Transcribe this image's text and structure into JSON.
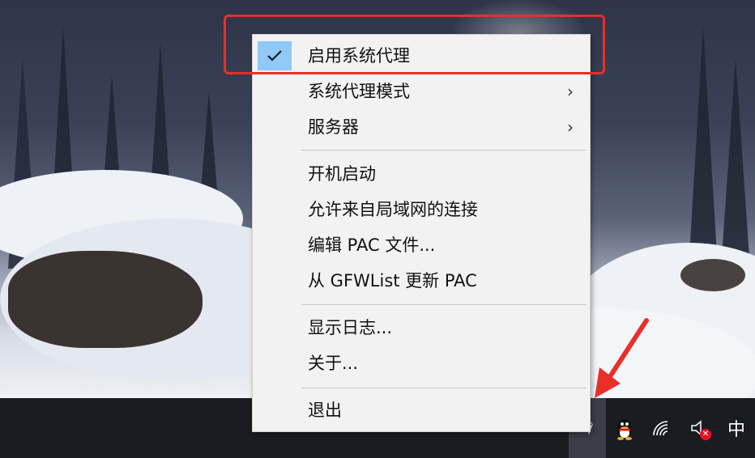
{
  "menu": {
    "items": [
      {
        "label": "启用系统代理",
        "checked": true,
        "submenu": false
      },
      {
        "label": "系统代理模式",
        "checked": false,
        "submenu": true
      },
      {
        "label": "服务器",
        "checked": false,
        "submenu": true
      },
      {
        "label": "开机启动",
        "checked": false,
        "submenu": false
      },
      {
        "label": "允许来自局域网的连接",
        "checked": false,
        "submenu": false
      },
      {
        "label": "编辑 PAC 文件...",
        "checked": false,
        "submenu": false
      },
      {
        "label": "从 GFWList 更新 PAC",
        "checked": false,
        "submenu": false
      },
      {
        "label": "显示日志...",
        "checked": false,
        "submenu": false
      },
      {
        "label": "关于...",
        "checked": false,
        "submenu": false
      },
      {
        "label": "退出",
        "checked": false,
        "submenu": false
      }
    ],
    "check_glyph": "✓",
    "submenu_glyph": "›"
  },
  "tray": {
    "overflow_glyph": "^",
    "ime_label": "中",
    "icons": [
      "chevron-up-icon",
      "shadowsocks-icon",
      "qq-icon",
      "wifi-icon",
      "volume-muted-icon"
    ]
  },
  "annotation": {
    "highlight_color": "#e82f2a",
    "arrow_color": "#e82f2a"
  }
}
